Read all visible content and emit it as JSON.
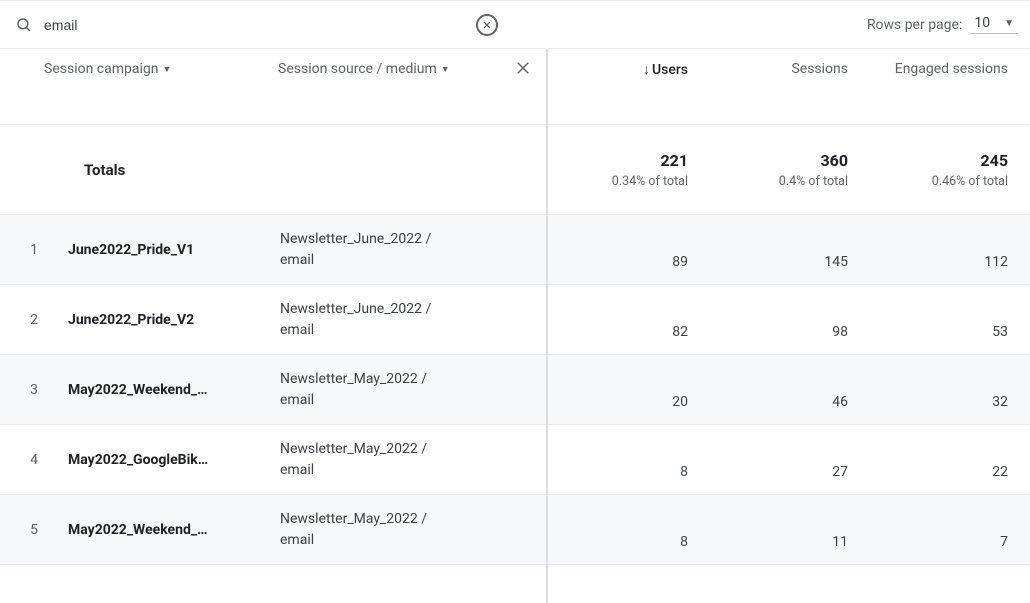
{
  "search": {
    "value": "email"
  },
  "rows_per_page": {
    "label": "Rows per page:",
    "value": "10"
  },
  "columns": {
    "dim1": "Session campaign",
    "dim2": "Session source / medium",
    "metrics": [
      "Users",
      "Sessions",
      "Engaged sessions"
    ],
    "sorted_metric_index": 0
  },
  "totals": {
    "label": "Totals",
    "values": [
      "221",
      "360",
      "245"
    ],
    "pct": [
      "0.34% of total",
      "0.4% of total",
      "0.46% of total"
    ]
  },
  "rows": [
    {
      "n": "1",
      "campaign": "June2022_Pride_V1",
      "source_medium": "Newsletter_June_2022 / email",
      "users": "89",
      "sessions": "145",
      "engaged": "112"
    },
    {
      "n": "2",
      "campaign": "June2022_Pride_V2",
      "source_medium": "Newsletter_June_2022 / email",
      "users": "82",
      "sessions": "98",
      "engaged": "53"
    },
    {
      "n": "3",
      "campaign": "May2022_Weekend_…",
      "source_medium": "Newsletter_May_2022 / email",
      "users": "20",
      "sessions": "46",
      "engaged": "32"
    },
    {
      "n": "4",
      "campaign": "May2022_GoogleBik…",
      "source_medium": "Newsletter_May_2022 / email",
      "users": "8",
      "sessions": "27",
      "engaged": "22"
    },
    {
      "n": "5",
      "campaign": "May2022_Weekend_…",
      "source_medium": "Newsletter_May_2022 / email",
      "users": "8",
      "sessions": "11",
      "engaged": "7"
    }
  ]
}
